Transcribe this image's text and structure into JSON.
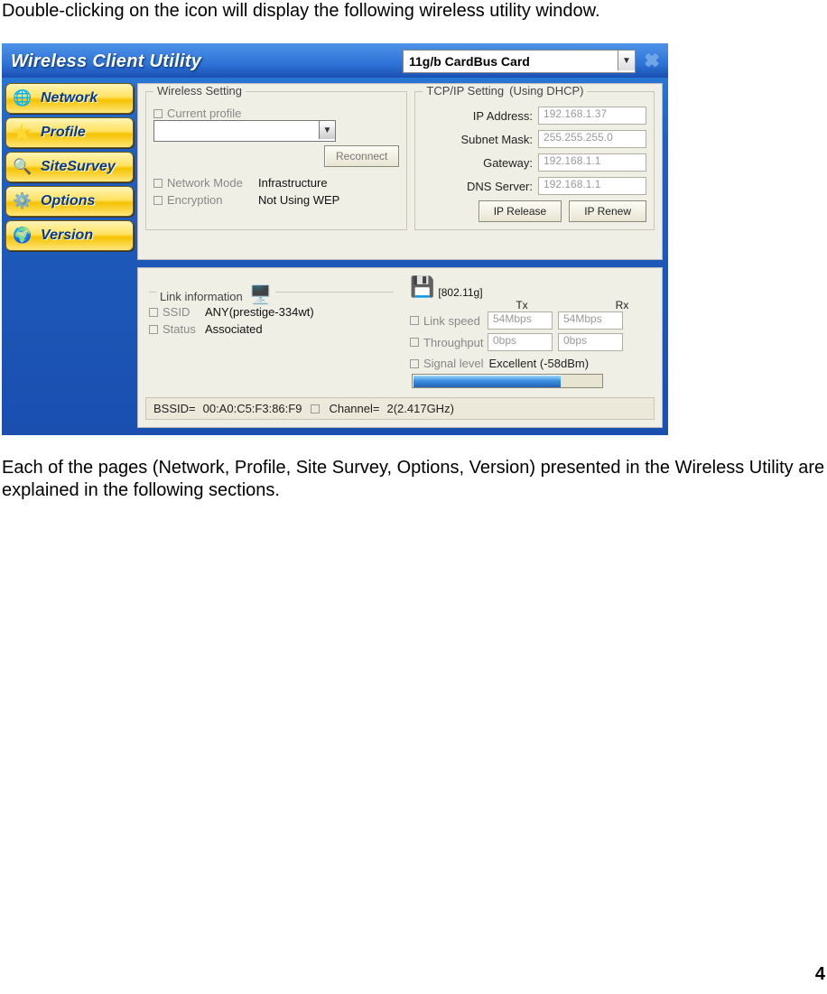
{
  "intro_text": "Double-clicking on the icon will display the following wireless utility window.",
  "outro_text": "Each of the pages (Network, Profile, Site Survey, Options, Version) presented in the Wireless Utility are explained in the following sections.",
  "page_number": "4",
  "titlebar": {
    "title": "Wireless Client Utility",
    "selected_card": "11g/b CardBus Card"
  },
  "nav": {
    "items": [
      {
        "label": "Network",
        "glyph": "🌐"
      },
      {
        "label": "Profile",
        "glyph": "⭐"
      },
      {
        "label": "SiteSurvey",
        "glyph": "🔍"
      },
      {
        "label": "Options",
        "glyph": "⚙️"
      },
      {
        "label": "Version",
        "glyph": "🌍"
      }
    ]
  },
  "wireless": {
    "legend": "Wireless Setting",
    "current_profile_label": "Current profile",
    "current_profile_value": "",
    "reconnect_label": "Reconnect",
    "network_mode_label": "Network Mode",
    "network_mode_value": "Infrastructure",
    "encryption_label": "Encryption",
    "encryption_value": "Not Using WEP"
  },
  "tcpip": {
    "legend": "TCP/IP Setting",
    "extra": "(Using DHCP)",
    "ip_label": "IP Address:",
    "ip_value": "192.168.1.37",
    "mask_label": "Subnet Mask:",
    "mask_value": "255.255.255.0",
    "gw_label": "Gateway:",
    "gw_value": "192.168.1.1",
    "dns_label": "DNS Server:",
    "dns_value": "192.168.1.1",
    "release_label": "IP Release",
    "renew_label": "IP Renew"
  },
  "link": {
    "legend": "Link information",
    "ssid_label": "SSID",
    "ssid_value": "ANY(prestige-334wt)",
    "status_label": "Status",
    "status_value": "Associated",
    "mode_badge": "[802.11g]",
    "tx_header": "Tx",
    "rx_header": "Rx",
    "linkspeed_label": "Link speed",
    "linkspeed_tx": "54Mbps",
    "linkspeed_rx": "54Mbps",
    "throughput_label": "Throughput",
    "throughput_tx": "0bps",
    "throughput_rx": "0bps",
    "signal_label": "Signal level",
    "signal_value": "Excellent (-58dBm)"
  },
  "statusbar": {
    "bssid_label": "BSSID=",
    "bssid_value": "00:A0:C5:F3:86:F9",
    "channel_label": "Channel=",
    "channel_value": "2(2.417GHz)"
  }
}
